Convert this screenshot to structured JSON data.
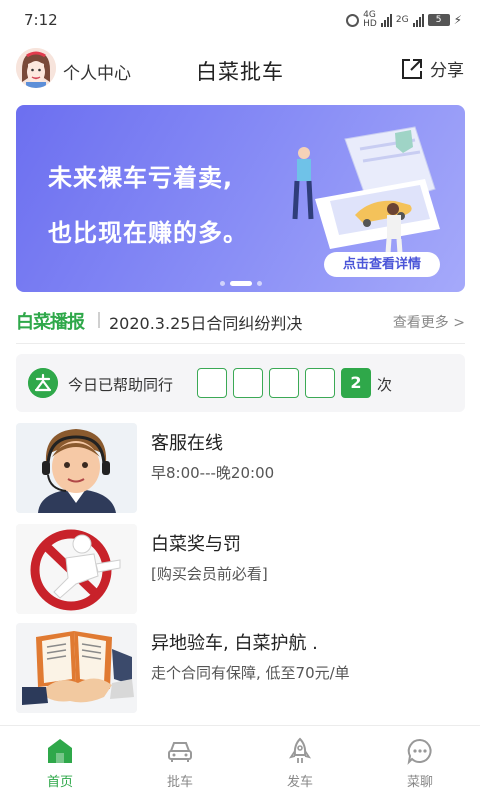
{
  "status_bar": {
    "time": "7:12",
    "network_hd": "HD",
    "network_4g": "4G",
    "network_2g": "2G",
    "battery": "5",
    "icons": [
      "alarm-icon",
      "signal-icon",
      "battery-icon",
      "charging-icon"
    ]
  },
  "header": {
    "profile_label": "个人中心",
    "title": "白菜批车",
    "share_label": "分享"
  },
  "banner": {
    "line1": "未来裸车亏着卖,",
    "line2": "也比现在赚的多。",
    "cta": "点击查看详情",
    "slide_count": 3,
    "active_slide": 2
  },
  "news": {
    "logo": "白菜播报",
    "headline": "2020.3.25日合同纠纷判决",
    "more": "查看更多 >"
  },
  "helped": {
    "label": "今日已帮助同行",
    "digits": [
      "",
      "",
      "",
      "",
      "2"
    ],
    "unit": "次"
  },
  "services": [
    {
      "title": "客服在线",
      "subtitle": "早8:00---晚20:00",
      "image": "customer-service-agent"
    },
    {
      "title": "白菜奖与罚",
      "subtitle": "[购买会员前必看]",
      "image": "prohibited-sign"
    },
    {
      "title": "异地验车, 白菜护航 .",
      "subtitle": "走个合同有保障, 低至70元/单",
      "image": "contract-handshake"
    }
  ],
  "tabs": [
    {
      "label": "首页",
      "icon": "home-icon",
      "active": true
    },
    {
      "label": "批车",
      "icon": "car-icon",
      "active": false
    },
    {
      "label": "发车",
      "icon": "rocket-icon",
      "active": false
    },
    {
      "label": "菜聊",
      "icon": "chat-icon",
      "active": false
    }
  ],
  "colors": {
    "accent": "#2fa84a",
    "banner": "#7b7ff3",
    "banner_cta_text": "#4b55d8"
  }
}
